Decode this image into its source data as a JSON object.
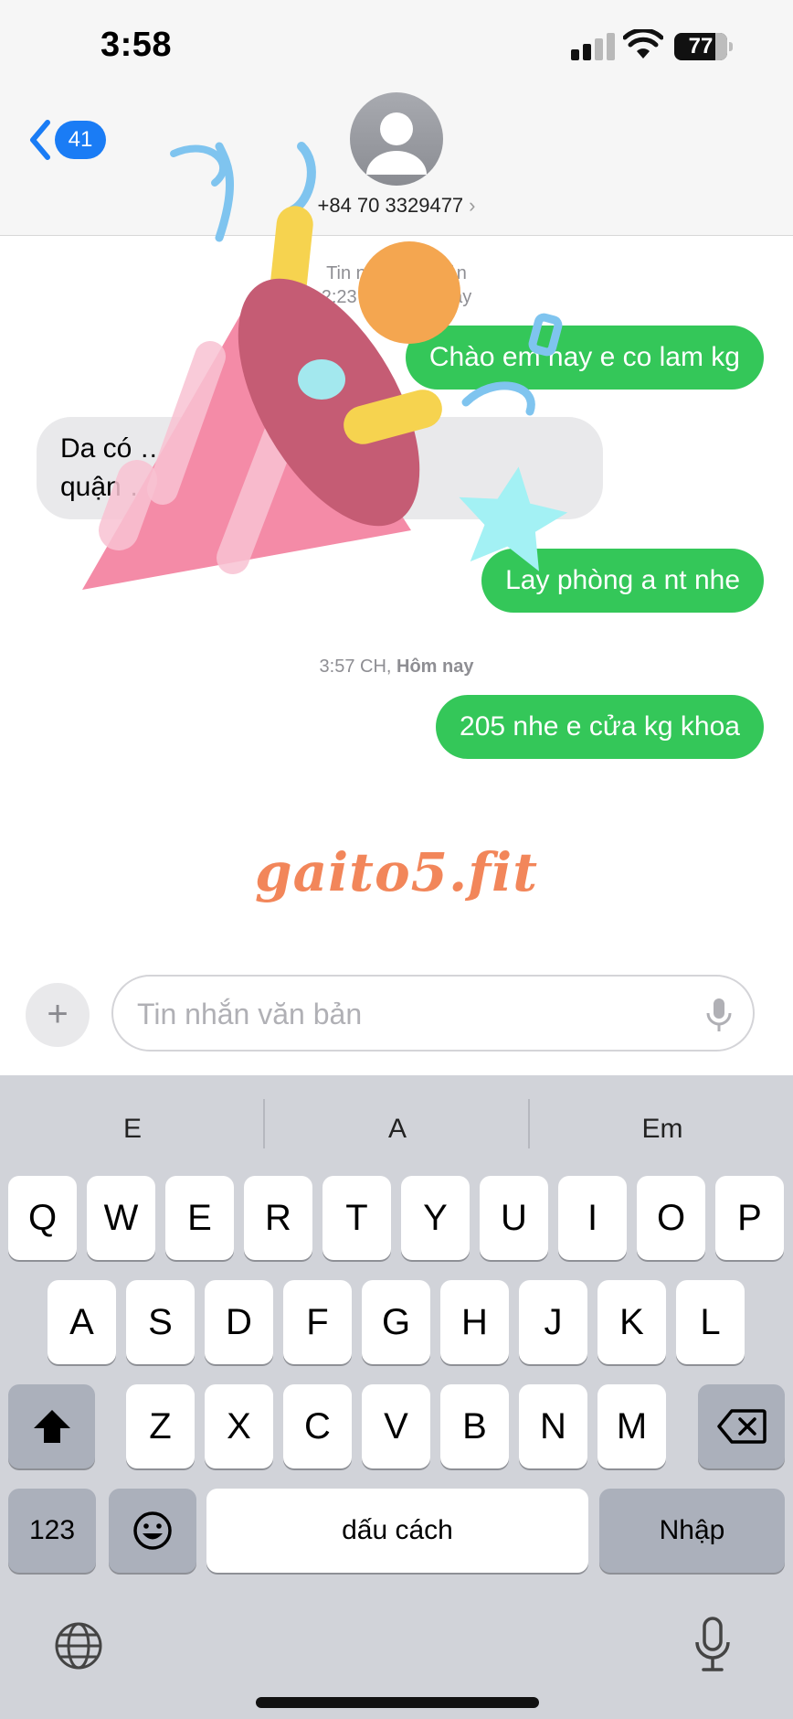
{
  "status_bar": {
    "time": "3:58",
    "battery_level": "77"
  },
  "header": {
    "back_badge": "41",
    "contact_number": "+84 70 3329477",
    "chevron": "›"
  },
  "conversation": {
    "timestamp_1_line1": "Tin nhắn văn bản",
    "timestamp_1_line2": "2:23 CH, Hôm nay",
    "messages": [
      {
        "direction": "outgoing",
        "text": "Chào em nay e co lam kg"
      },
      {
        "direction": "incoming",
        "line1": "Da có … thai bình p4",
        "line2": "quận … h nha"
      },
      {
        "direction": "outgoing",
        "text": "Lay phòng a nt nhe"
      }
    ],
    "timestamp_2": {
      "time": "3:57 CH,",
      "day": "Hôm nay"
    },
    "last_message": {
      "direction": "outgoing",
      "text": "205 nhe e cửa kg khoa"
    },
    "sticker": "party-popper-sticker"
  },
  "watermark": "gaito5.fit",
  "compose": {
    "plus": "+",
    "placeholder": "Tin nhắn văn bản"
  },
  "keyboard": {
    "predictions": [
      "E",
      "A",
      "Em"
    ],
    "row1": [
      "Q",
      "W",
      "E",
      "R",
      "T",
      "Y",
      "U",
      "I",
      "O",
      "P"
    ],
    "row2": [
      "A",
      "S",
      "D",
      "F",
      "G",
      "H",
      "J",
      "K",
      "L"
    ],
    "row3": [
      "Z",
      "X",
      "C",
      "V",
      "B",
      "N",
      "M"
    ],
    "numbers_key": "123",
    "space_key": "dấu cách",
    "return_key": "Nhập"
  },
  "colors": {
    "outgoing_bubble": "#34c759",
    "incoming_bubble": "#e9e9eb",
    "accent": "#1a7cf5",
    "watermark": "#f2865a"
  }
}
